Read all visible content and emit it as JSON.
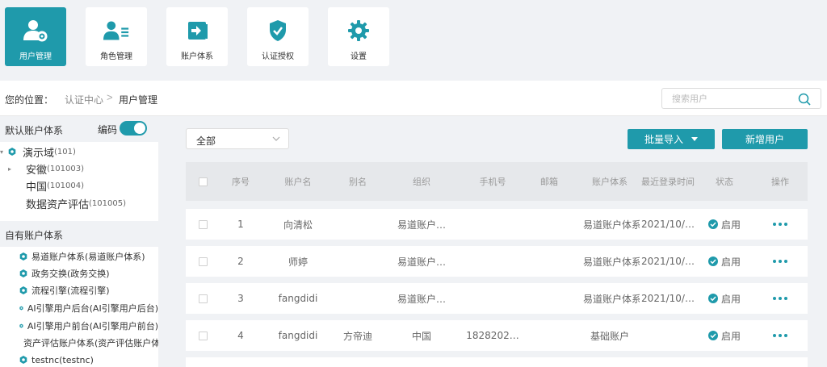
{
  "theme": {
    "accent": "#1f9aab",
    "background": "#f0f2f5"
  },
  "toolbar": [
    {
      "label": "用户管理",
      "icon": "user-gear-icon",
      "active": true
    },
    {
      "label": "角色管理",
      "icon": "user-list-icon",
      "active": false
    },
    {
      "label": "账户体系",
      "icon": "sign-in-icon",
      "active": false
    },
    {
      "label": "认证授权",
      "icon": "shield-check-icon",
      "active": false
    },
    {
      "label": "设置",
      "icon": "gear-icon",
      "active": false
    }
  ],
  "breadcrumb": {
    "label": "您的位置：",
    "parent": "认证中心",
    "separator": ">",
    "current": "用户管理"
  },
  "search": {
    "placeholder": "搜索用户",
    "value": ""
  },
  "sidebar": {
    "default_title": "默认账户体系",
    "code_label": "编码",
    "code_toggle_on": true,
    "default_tree": [
      {
        "name": "演示域",
        "code": "(101)"
      },
      {
        "name": "安徽",
        "code": "(101003)"
      },
      {
        "name": "中国",
        "code": "(101004)"
      },
      {
        "name": "数据资产评估",
        "code": "(101005)"
      }
    ],
    "own_title": "自有账户体系",
    "own_systems": [
      "易道账户体系(易道账户体系)",
      "政务交换(政务交换)",
      "流程引擎(流程引擎)",
      "AI引擎用户后台(AI引擎用户后台)",
      "AI引擎用户前台(AI引擎用户前台)",
      "资产评估账户体系(资产评估账户体系)",
      "testnc(testnc)"
    ]
  },
  "filter": {
    "selected": "全部"
  },
  "actions": {
    "import_label": "批量导入",
    "add_label": "新增用户"
  },
  "table": {
    "columns": [
      "序号",
      "账户名",
      "别名",
      "组织",
      "手机号",
      "邮箱",
      "账户体系",
      "最近登录时间",
      "状态",
      "操作"
    ],
    "rows": [
      {
        "index": "1",
        "account": "向清松",
        "alias": "",
        "org": "易道账户…",
        "phone": "",
        "email": "",
        "system": "易道账户体系",
        "last_login": "2021/10/…",
        "status": "启用"
      },
      {
        "index": "2",
        "account": "师婷",
        "alias": "",
        "org": "易道账户…",
        "phone": "",
        "email": "",
        "system": "易道账户体系",
        "last_login": "2021/10/…",
        "status": "启用"
      },
      {
        "index": "3",
        "account": "fangdidi",
        "alias": "",
        "org": "易道账户…",
        "phone": "",
        "email": "",
        "system": "易道账户体系",
        "last_login": "2021/10/…",
        "status": "启用"
      },
      {
        "index": "4",
        "account": "fangdidi",
        "alias": "方帝迪",
        "org": "中国",
        "phone": "1828202…",
        "email": "",
        "system": "基础账户",
        "last_login": "",
        "status": "启用"
      }
    ]
  }
}
